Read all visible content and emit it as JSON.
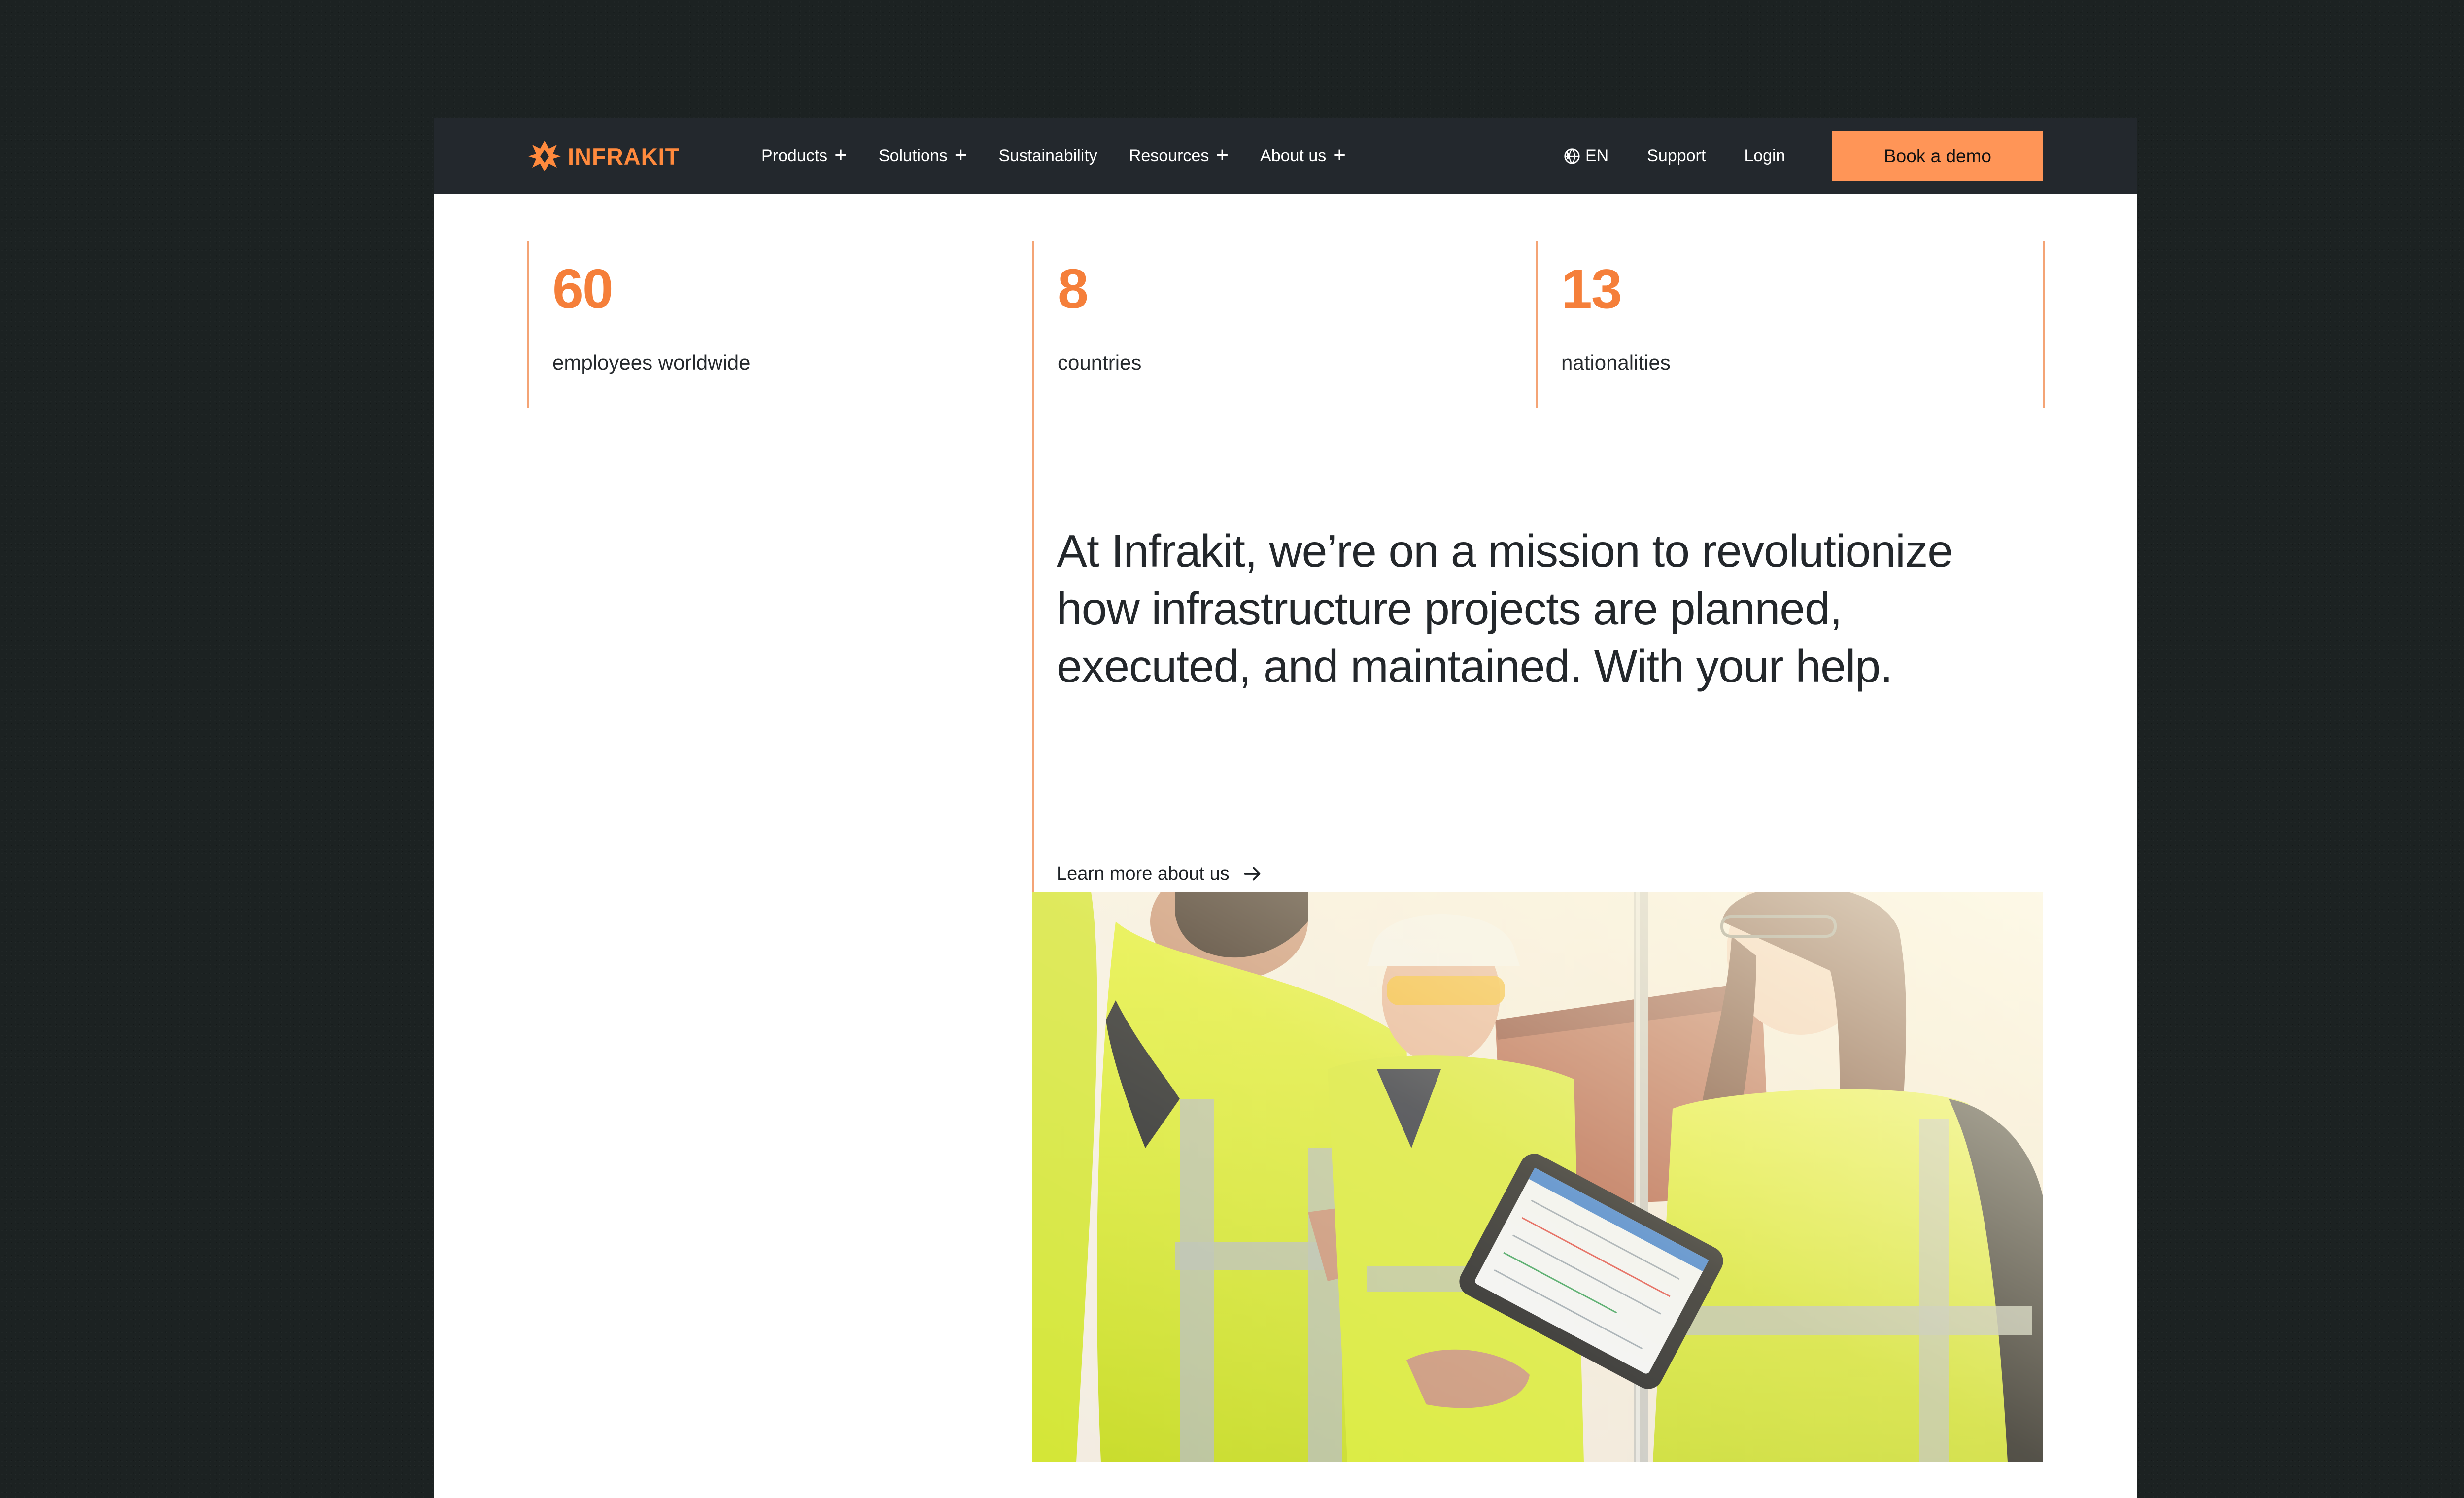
{
  "header": {
    "logo_text": "INFRAKIT",
    "menu": [
      {
        "label": "Products",
        "expandable": true
      },
      {
        "label": "Solutions",
        "expandable": true
      },
      {
        "label": "Sustainability",
        "expandable": false
      },
      {
        "label": "Resources",
        "expandable": true
      },
      {
        "label": "About us",
        "expandable": true
      }
    ],
    "language": "EN",
    "support_label": "Support",
    "login_label": "Login",
    "demo_button_label": "Book a demo"
  },
  "stats": [
    {
      "number": "60",
      "label": "employees worldwide"
    },
    {
      "number": "8",
      "label": "countries"
    },
    {
      "number": "13",
      "label": "nationalities"
    }
  ],
  "mission": {
    "text": "At Infrakit, we’re on a mission to revolutionize how infrastructure projects are planned, executed, and maintained. With your help.",
    "link_label": "Learn more about us"
  },
  "colors": {
    "page_background": "#1c2222",
    "header_background": "#23282d",
    "accent_orange": "#ff8a3d",
    "button_orange": "#ff9557",
    "divider_orange": "#f4a476",
    "text_dark": "#23272b"
  },
  "icons": {
    "logo": "infrakit-logo-icon",
    "language": "globe-icon",
    "expand": "plus-icon",
    "link": "arrow-right-icon"
  },
  "photo": {
    "subject": "workers-in-hi-vis-vests-with-tablet"
  }
}
